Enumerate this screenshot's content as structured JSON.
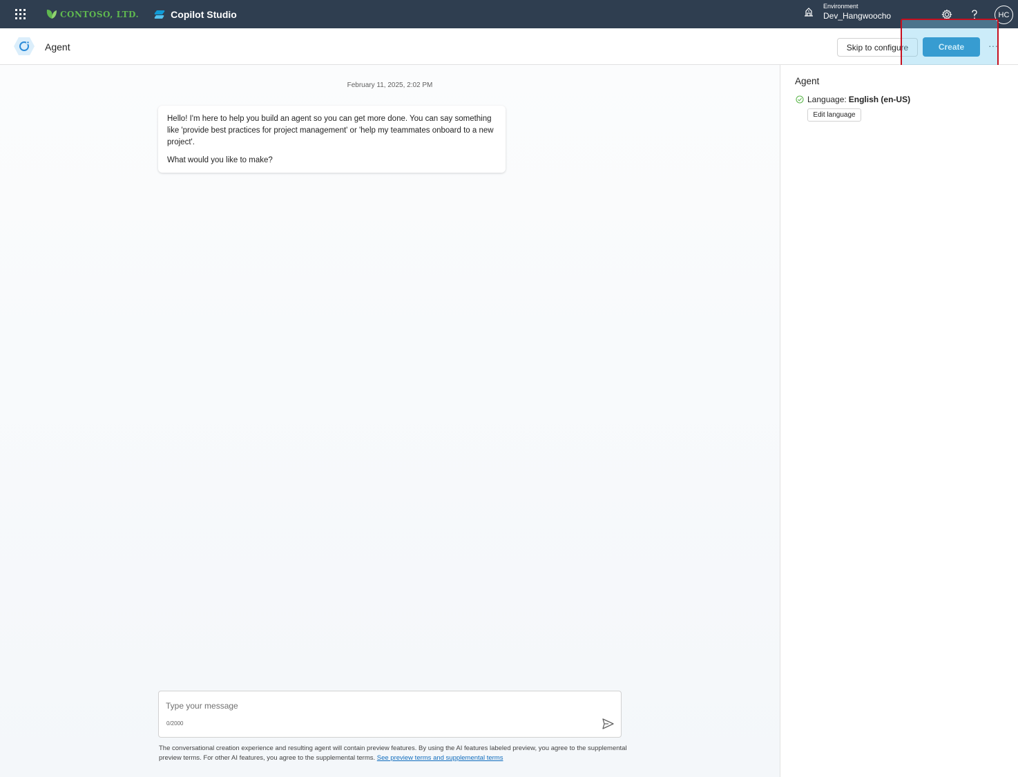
{
  "topbar": {
    "brand": "CONTOSO, LTD.",
    "product": "Copilot Studio",
    "environment_label": "Environment",
    "environment_name": "Dev_Hangwoocho",
    "avatar_initials": "HC"
  },
  "header": {
    "title": "Agent",
    "skip_label": "Skip to configure",
    "create_label": "Create",
    "more_label": "···"
  },
  "chat": {
    "timestamp": "February 11, 2025, 2:02 PM",
    "bot_message_1": "Hello! I'm here to help you build an agent so you can get more done. You can say something like 'provide best practices for project management' or 'help my teammates onboard to a new project'.",
    "bot_message_2": "What would you like to make?",
    "input_placeholder": "Type your message",
    "char_counter": "0/2000",
    "disclaimer": "The conversational creation experience and resulting agent will contain preview features. By using the AI features labeled preview, you agree to the supplemental preview terms. For other AI features, you agree to the supplemental terms.",
    "disclaimer_link": "See preview terms and supplemental terms"
  },
  "right_pane": {
    "title": "Agent",
    "language_label": "Language:",
    "language_value": "English (en-US)",
    "edit_language_label": "Edit language"
  },
  "colors": {
    "topbar": "#2f3e50",
    "brand_green": "#5fb84f",
    "create_button": "#0f7fbf",
    "highlight_border": "#c50f1f",
    "link": "#0f6cbd"
  }
}
